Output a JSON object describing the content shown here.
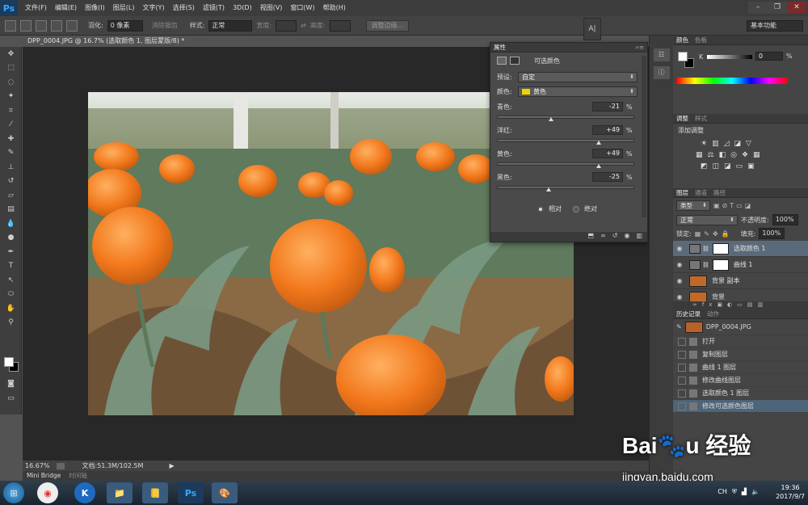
{
  "app": {
    "logo": "Ps"
  },
  "menu": [
    "文件(F)",
    "编辑(E)",
    "图像(I)",
    "图层(L)",
    "文字(Y)",
    "选择(S)",
    "滤镜(T)",
    "3D(D)",
    "视图(V)",
    "窗口(W)",
    "帮助(H)"
  ],
  "options": {
    "feather_label": "羽化:",
    "feather_value": "0 像素",
    "antialias": "消除锯齿",
    "style_label": "样式:",
    "style_value": "正常",
    "width_label": "宽度:",
    "height_label": "高度:",
    "refine_edge": "调整边缘...",
    "workspace": "基本功能"
  },
  "document": {
    "tab_title": "DPP_0004.JPG @ 16.7% (选取颜色 1, 图层蒙版/8) *",
    "zoom": "16.67%",
    "doc_size": "文档:51.3M/102.5M"
  },
  "bottom_tabs": [
    "Mini Bridge",
    "时间轴"
  ],
  "properties": {
    "header": "属性",
    "title": "可选颜色",
    "preset_label": "预设:",
    "preset_value": "自定",
    "colors_label": "颜色:",
    "colors_value": "黄色",
    "colors_swatch": "#f2d000",
    "sliders": [
      {
        "label": "青色:",
        "value": "-21",
        "unit": "%",
        "percent": -21
      },
      {
        "label": "洋红:",
        "value": "+49",
        "unit": "%",
        "percent": 49
      },
      {
        "label": "黄色:",
        "value": "+49",
        "unit": "%",
        "percent": 49
      },
      {
        "label": "黑色:",
        "value": "-25",
        "unit": "%",
        "percent": -25
      }
    ],
    "method_relative": "相对",
    "method_absolute": "绝对"
  },
  "color_panel": {
    "tabs": [
      "颜色",
      "色板"
    ],
    "k_label": "K",
    "k_value": "0",
    "k_unit": "%"
  },
  "adjust_panel": {
    "tabs": [
      "调整",
      "样式"
    ],
    "title": "添加调整"
  },
  "layers_panel": {
    "tabs": [
      "图层",
      "通道",
      "路径"
    ],
    "filter": "类型",
    "blend_mode": "正常",
    "opacity_label": "不透明度:",
    "opacity_value": "100%",
    "lock_label": "锁定:",
    "fill_label": "填充:",
    "fill_value": "100%",
    "layers": [
      {
        "name": "选取颜色 1",
        "type": "adjust"
      },
      {
        "name": "曲线 1",
        "type": "adjust"
      },
      {
        "name": "背景 副本",
        "type": "image"
      },
      {
        "name": "背景",
        "type": "image"
      }
    ]
  },
  "history_panel": {
    "tabs": [
      "历史记录",
      "动作"
    ],
    "snapshot": "DPP_0004.JPG",
    "items": [
      "打开",
      "复制图层",
      "曲线 1 图层",
      "修改曲线图层",
      "选取颜色 1 图层",
      "修改可选颜色图层"
    ]
  },
  "taskbar": {
    "time": "19:36",
    "date": "2017/9/7",
    "ime": "CH"
  },
  "watermark": {
    "brand": "Baidu 经验",
    "url": "jingyan.baidu.com"
  }
}
